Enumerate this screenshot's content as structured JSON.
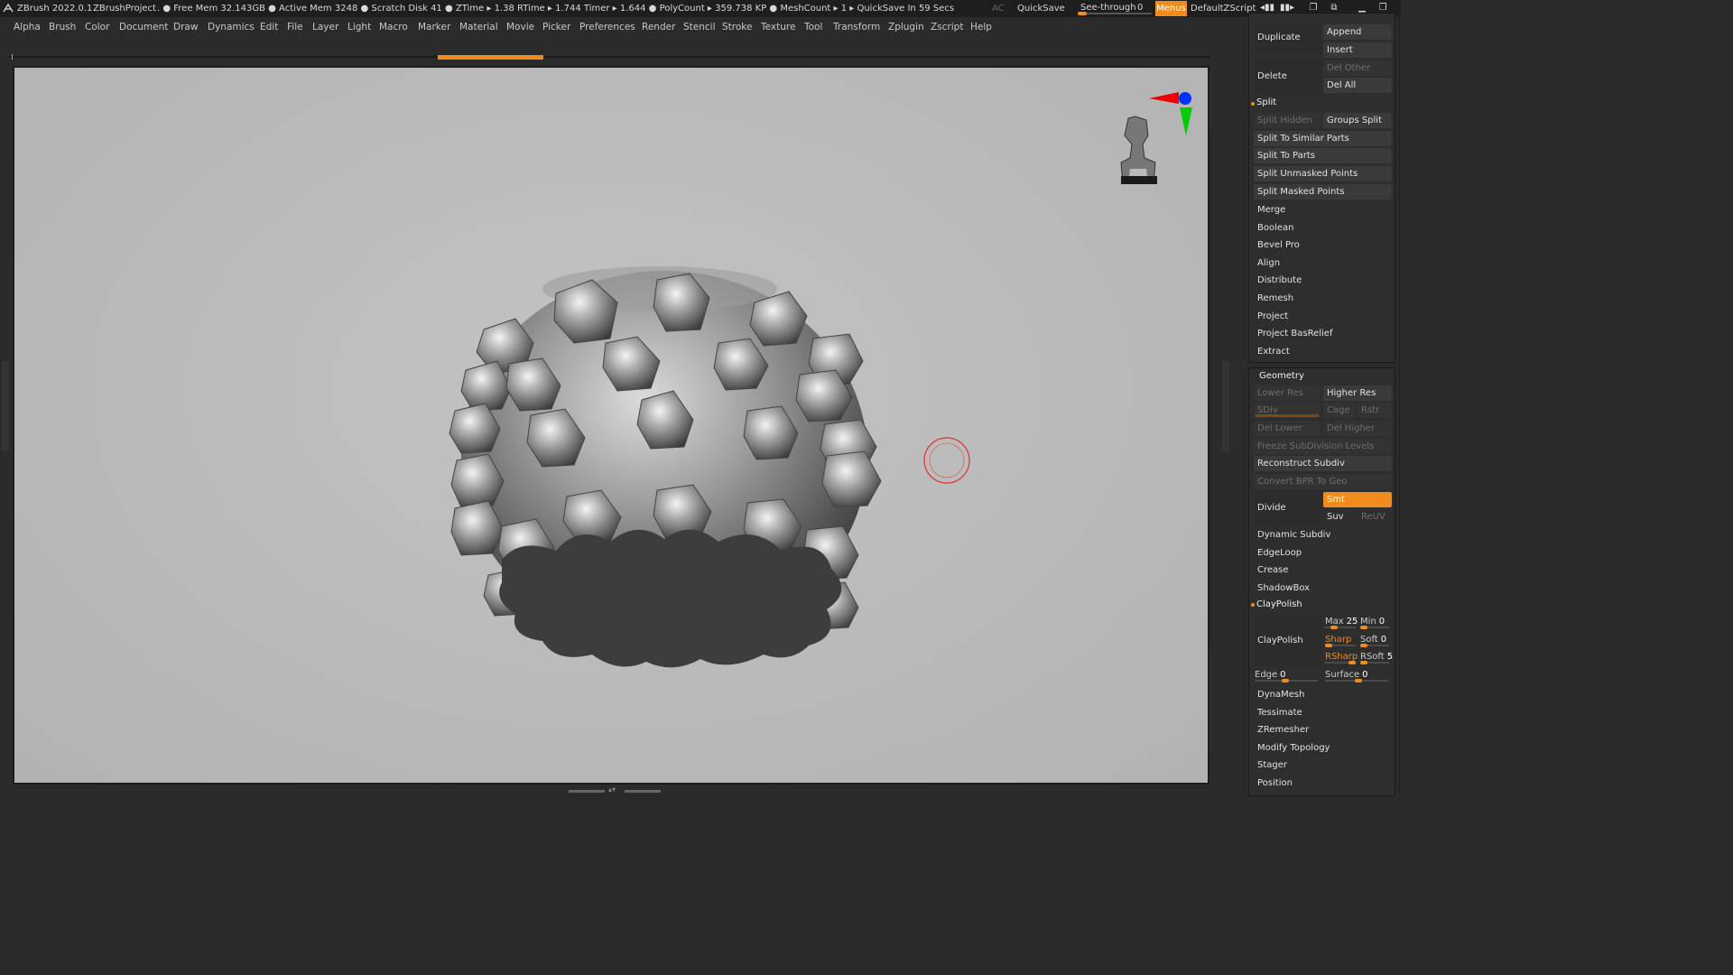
{
  "titlebar": {
    "app": "ZBrush 2022.0.1",
    "project": "ZBrushProject",
    "stats": ". ● Free Mem 32.143GB ● Active Mem 3248 ● Scratch Disk 41 ●  ZTime ▸ 1.38 RTime ▸ 1.744 Timer ▸ 1.644 ● PolyCount ▸ 359.738 KP  ● MeshCount ▸ 1   ▸ QuickSave In 59 Secs",
    "ac": "AC",
    "quicksave": "QuickSave",
    "seethrough_label": "See-through",
    "seethrough_value": "0",
    "seethrough_level": 0,
    "menus": "Menus",
    "script": "DefaultZScript"
  },
  "menubar": [
    "Alpha",
    "Brush",
    "Color",
    "Document",
    "Draw",
    "Dynamics",
    "Edit",
    "File",
    "Layer",
    "Light",
    "Macro",
    "Marker",
    "Material",
    "Movie",
    "Picker",
    "Preferences",
    "Render",
    "Stencil",
    "Stroke",
    "Texture",
    "Tool",
    "Transform",
    "Zplugin",
    "Zscript",
    "Help"
  ],
  "panel": {
    "subtool": {
      "duplicate": "Duplicate",
      "append": "Append",
      "insert": "Insert",
      "delete": "Delete",
      "del_other": "Del Other",
      "del_all": "Del All",
      "split": "Split",
      "split_hidden": "Split Hidden",
      "groups_split": "Groups Split",
      "split_similar": "Split To Similar Parts",
      "split_parts": "Split To Parts",
      "split_unmasked": "Split Unmasked Points",
      "split_masked": "Split Masked Points",
      "merge": "Merge",
      "boolean": "Boolean",
      "bevel_pro": "Bevel Pro",
      "align": "Align",
      "distribute": "Distribute",
      "remesh": "Remesh",
      "project": "Project",
      "project_basrelief": "Project BasRelief",
      "extract": "Extract"
    },
    "geometry": {
      "title": "Geometry",
      "lower_res": "Lower Res",
      "higher_res": "Higher Res",
      "sdiv": "SDiv",
      "cage": "Cage",
      "rstr": "Rstr",
      "del_lower": "Del Lower",
      "del_higher": "Del Higher",
      "freeze": "Freeze SubDivision Levels",
      "reconstruct": "Reconstruct Subdiv",
      "convert_bpr": "Convert BPR To Geo",
      "divide": "Divide",
      "smt": "Smt",
      "suv": "Suv",
      "reuv": "ReUV",
      "dynamic_subdiv": "Dynamic Subdiv",
      "edgeloop": "EdgeLoop",
      "crease": "Crease",
      "shadowbox": "ShadowBox",
      "claypolish_section": "ClayPolish",
      "claypolish_btn": "ClayPolish",
      "max_label": "Max",
      "max_val": "25",
      "min_label": "Min",
      "min_val": "0",
      "sharp_label": "Sharp",
      "soft_label": "Soft",
      "soft_val": "0",
      "rsharp_label": "RSharp",
      "rsoft_label": "RSoft",
      "rsoft_val": "5",
      "edge_label": "Edge",
      "edge_val": "0",
      "surface_label": "Surface",
      "surface_val": "0",
      "dynamesh": "DynaMesh",
      "tessimate": "Tessimate",
      "zremesher": "ZRemesher",
      "modify_topology": "Modify Topology",
      "stager": "Stager",
      "position": "Position"
    }
  },
  "colors": {
    "accent": "#f08c1c",
    "panel_bg": "#2e2e2e",
    "viewport_bg": "#bcbcbc"
  },
  "icons": [
    "zbrush-logo-icon",
    "window-minimize-icon",
    "window-restore-icon",
    "window-close-icon",
    "gizmo-axis-icon",
    "nav-mannequin-icon",
    "brush-cursor-icon"
  ]
}
